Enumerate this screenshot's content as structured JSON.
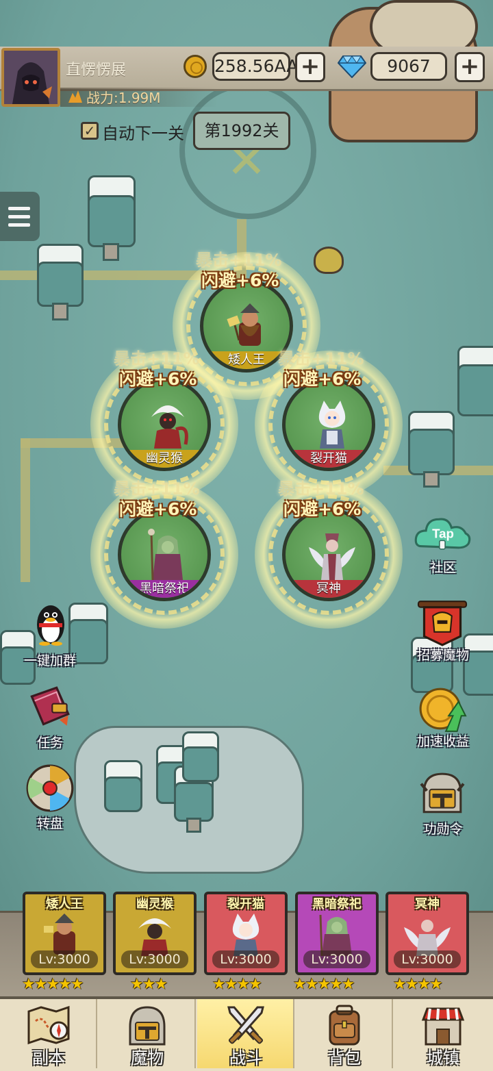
{
  "player": {
    "name": "直愣愣展",
    "power_label": "战力:1.99M"
  },
  "currency": {
    "gold": "258.56AA",
    "gems": "9067",
    "plus": "+"
  },
  "stage": {
    "auto_next_label": "自动下一关",
    "auto_next_checked": true,
    "check_mark": "✓",
    "current_stage": "第1992关"
  },
  "formation": [
    {
      "name": "矮人王",
      "crit": "暴击+11%",
      "dodge": "闪避+6%",
      "band_color": "#c9a21c"
    },
    {
      "name": "幽灵猴",
      "crit": "暴击+11%",
      "dodge": "闪避+6%",
      "band_color": "#c9a21c"
    },
    {
      "name": "裂开猫",
      "crit": "暴击+11%",
      "dodge": "闪避+6%",
      "band_color": "#b8343c"
    },
    {
      "name": "黑暗祭祀",
      "crit": "暴击+11%",
      "dodge": "闪避+6%",
      "band_color": "#9a2fa0"
    },
    {
      "name": "冥神",
      "crit": "暴击+11%",
      "dodge": "闪避+6%",
      "band_color": "#b8343c"
    }
  ],
  "side_left": [
    {
      "label": "一键加群",
      "icon": "penguin-icon"
    },
    {
      "label": "任务",
      "icon": "quest-book-icon"
    },
    {
      "label": "转盘",
      "icon": "wheel-icon"
    }
  ],
  "side_right": [
    {
      "label": "社区",
      "icon": "taptap-cloud-icon",
      "icon_text": "Tap"
    },
    {
      "label": "招募魔物",
      "icon": "recruit-banner-icon"
    },
    {
      "label": "加速收益",
      "icon": "speed-coin-icon"
    },
    {
      "label": "功勋令",
      "icon": "helmet-icon"
    }
  ],
  "lineup": [
    {
      "name": "矮人王",
      "level": "Lv:3000",
      "stars": "★★★★★",
      "bg": "#c9a834"
    },
    {
      "name": "幽灵猴",
      "level": "Lv:3000",
      "stars": "★★★",
      "bg": "#c9a834"
    },
    {
      "name": "裂开猫",
      "level": "Lv:3000",
      "stars": "★★★★",
      "bg": "#d9595e"
    },
    {
      "name": "黑暗祭祀",
      "level": "Lv:3000",
      "stars": "★★★★★",
      "bg": "#b549b8"
    },
    {
      "name": "冥神",
      "level": "Lv:3000",
      "stars": "★★★★",
      "bg": "#d9595e"
    }
  ],
  "nav": [
    {
      "label": "副本",
      "icon": "map-compass-icon",
      "active": false
    },
    {
      "label": "魔物",
      "icon": "knight-helmet-icon",
      "active": false
    },
    {
      "label": "战斗",
      "icon": "crossed-swords-icon",
      "active": true
    },
    {
      "label": "背包",
      "icon": "backpack-icon",
      "active": false
    },
    {
      "label": "城镇",
      "icon": "shop-building-icon",
      "active": false
    }
  ],
  "colors": {
    "map_bg": "#77a9a3",
    "gold_coin": "#e0a820",
    "gem": "#4fb6f0",
    "active_tab": "#f6d870"
  }
}
